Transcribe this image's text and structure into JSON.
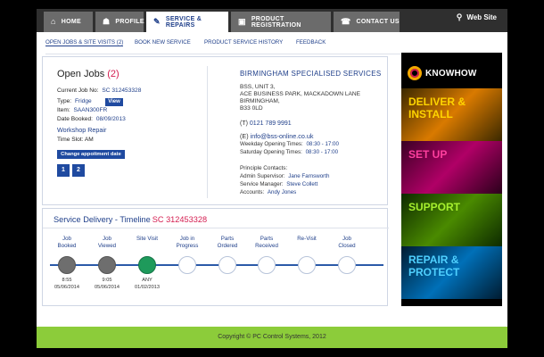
{
  "nav": {
    "tabs": [
      {
        "label": "HOME",
        "icon": "home-icon"
      },
      {
        "label": "PROFILE",
        "icon": "user-icon"
      },
      {
        "label": "SERVICE & REPAIRS",
        "icon": "wrench-icon"
      },
      {
        "label": "PRODUCT REGISTRATION",
        "icon": "box-icon"
      },
      {
        "label": "CONTACT US",
        "icon": "phone-icon"
      }
    ],
    "website_label": "Web Site"
  },
  "subnav": [
    "OPEN JOBS & SITE VISITS (2)",
    "BOOK NEW SERVICE",
    "PRODUCT SERVICE HISTORY",
    "FEEDBACK"
  ],
  "job": {
    "title": "Open Jobs",
    "count": "(2)",
    "current_job_label": "Current Job No:",
    "current_job_value": "SC 312453328",
    "type_label": "Type:",
    "type_value": "Fridge",
    "view_label": "View",
    "item_label": "Item:",
    "item_value": "SAAN300FR",
    "date_label": "Date Booked:",
    "date_value": "08/09/2013",
    "workshop": "Workshop Repair",
    "slot_label": "Time Slot:",
    "slot_value": "AM",
    "change_btn": "Change appoitment date",
    "pages": [
      "1",
      "2"
    ]
  },
  "bss": {
    "name": "BIRMINGHAM SPECIALISED SERVICES",
    "address": [
      "BSS, UNIT 3,",
      "ACE BUSINESS PARK, MACKADOWN LANE",
      "BIRMINGHAM,",
      "B33 0LD"
    ],
    "phone_label": "(T)",
    "phone": "0121 789 9991",
    "email_label": "(E)",
    "email": "info@bss-online.co.uk",
    "weekday_label": "Weekday Opening Times:",
    "weekday": "08:30 - 17:00",
    "saturday_label": "Saturday Opening Times:",
    "saturday": "08:30 - 17:00",
    "principle_label": "Principle Contacts:",
    "contacts": [
      {
        "role": "Admin Supervisor:",
        "name": "Jane Farnsworth"
      },
      {
        "role": "Service Manager:",
        "name": "Steve Collett"
      },
      {
        "role": "Accounts:",
        "name": "Andy Jones"
      }
    ]
  },
  "timeline": {
    "title": "Service Delivery - Timeline",
    "ref": "SC 312453328",
    "steps": [
      {
        "label": "Job\nBooked",
        "state": "done",
        "time": "8:55\n05/06/2014"
      },
      {
        "label": "Job\nViewed",
        "state": "done",
        "time": "9:05\n05/06/2014"
      },
      {
        "label": "Site Visit",
        "state": "active",
        "time": "ANY\n01/02/2013"
      },
      {
        "label": "Job in\nProgress",
        "state": "pending",
        "time": ""
      },
      {
        "label": "Parts\nOrdered",
        "state": "pending",
        "time": ""
      },
      {
        "label": "Parts\nReceived",
        "state": "pending",
        "time": ""
      },
      {
        "label": "Re-Visit",
        "state": "pending",
        "time": ""
      },
      {
        "label": "Job\nClosed",
        "state": "pending",
        "time": ""
      }
    ]
  },
  "banner": {
    "brand": "KNOWHOW",
    "panels": [
      "DELIVER & INSTALL",
      "SET UP",
      "SUPPORT",
      "REPAIR & PROTECT"
    ]
  },
  "footer": "Copyright © PC Control Systems, 2012",
  "colors": {
    "accent": "#1f3f8a",
    "highlight": "#d41d50",
    "footer": "#8ccc3a",
    "active_step": "#1e9a5b"
  }
}
